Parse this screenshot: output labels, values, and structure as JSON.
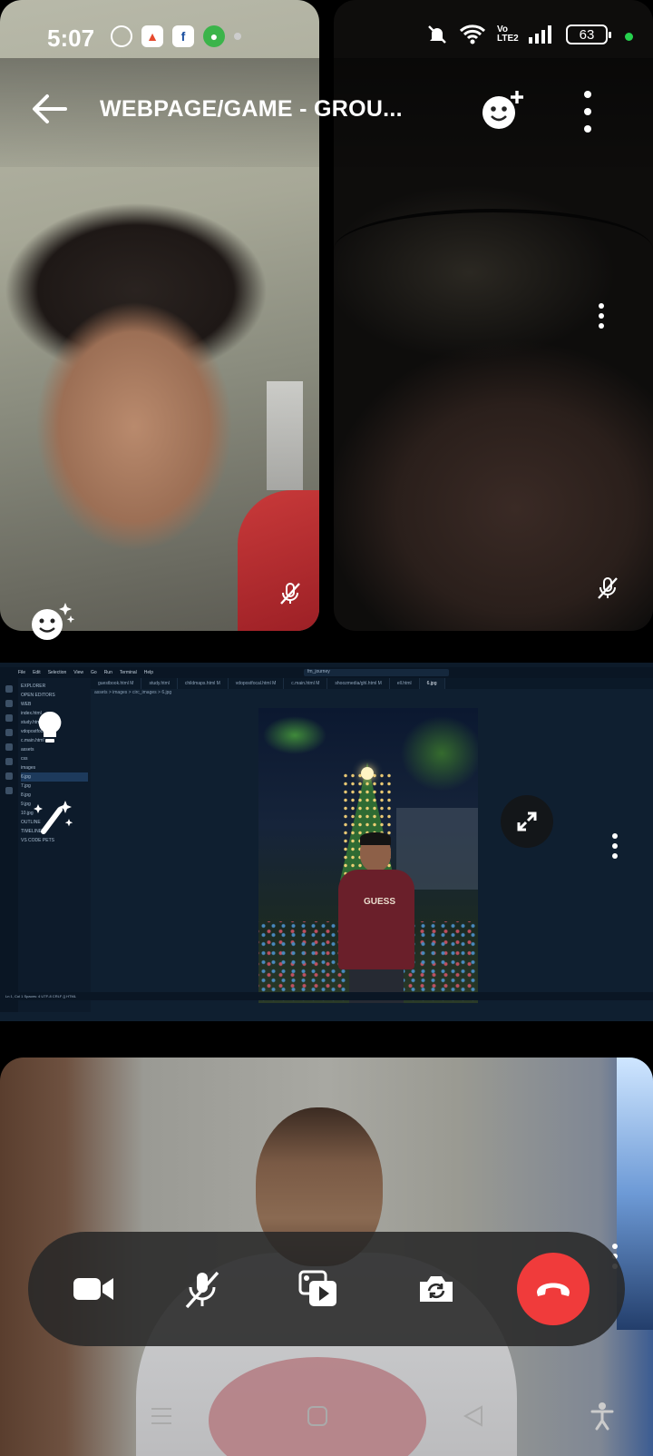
{
  "status_bar": {
    "time": "5:07",
    "notification_icons": [
      "messenger-icon",
      "photos-icon",
      "facebook-icon",
      "app-icon",
      "more-dot"
    ],
    "network": "Vo LTE2",
    "battery": "63",
    "charging_color": "#26d14e"
  },
  "header": {
    "title": "WEBPAGE/GAME - GROU..."
  },
  "screen_share": {
    "menus": [
      "File",
      "Edit",
      "Selection",
      "View",
      "Go",
      "Run",
      "Terminal",
      "Help"
    ],
    "search": "fm_journey",
    "tabs": [
      "guestbook.html M",
      "study.html",
      "childmaps.html M",
      "vdopostfocal.html M",
      "c.main.html M",
      "shoozmedia/ghl.html M",
      "ell.html",
      "6.jpg"
    ],
    "breadcrumb": "assets > images > circ_images > 6.jpg",
    "explorer": [
      "EXPLORER",
      "OPEN EDITORS",
      "WEB",
      "index.html",
      "study.html",
      "vdopostfocal.html",
      "c.main.html",
      "assets",
      "css",
      "images",
      "6.jpg",
      "7.jpg",
      "8.jpg",
      "9.jpg",
      "10.jpg",
      "OUTLINE",
      "TIMELINE",
      "VS CODE PETS"
    ],
    "selected_file": "6.jpg",
    "shirt_text": "GUESS",
    "status_text": "Ln 1, Col 1   Spaces: 4   UTF-8   CRLF   {} HTML"
  },
  "controls": {
    "buttons": [
      "camera-button",
      "mic-button",
      "share-screen-button",
      "flip-camera-button",
      "end-call-button"
    ],
    "end_color": "#f03b3b"
  }
}
